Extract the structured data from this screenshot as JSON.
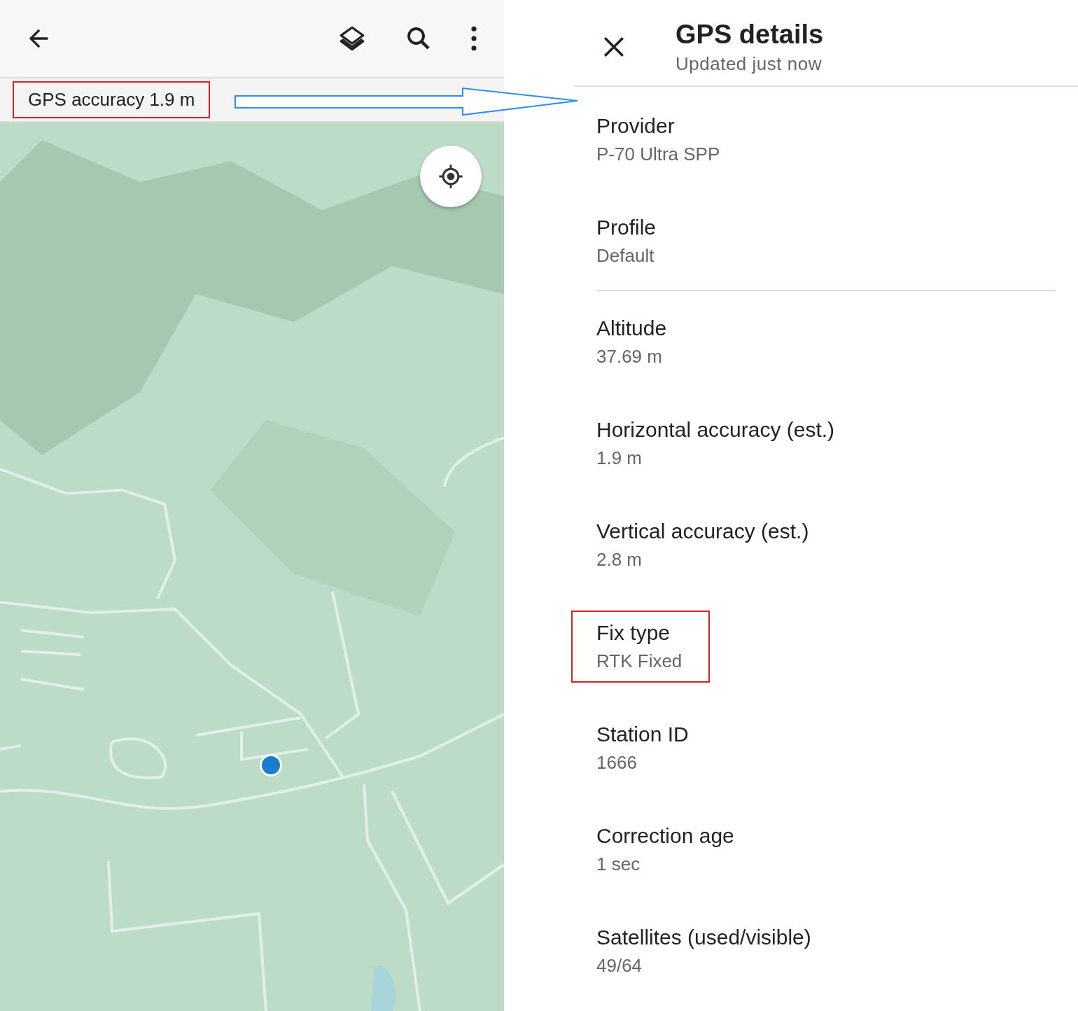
{
  "map_panel": {
    "accuracy_chip": {
      "text": "GPS accuracy 1.9 m",
      "highlighted": true
    }
  },
  "details_panel": {
    "title": "GPS details",
    "subtitle": "Updated just now",
    "items": [
      {
        "label": "Provider",
        "value": "P-70 Ultra SPP",
        "divider_after": false,
        "highlighted": false
      },
      {
        "label": "Profile",
        "value": "Default",
        "divider_after": true,
        "highlighted": false
      },
      {
        "label": "Altitude",
        "value": "37.69 m",
        "divider_after": false,
        "highlighted": false
      },
      {
        "label": "Horizontal accuracy (est.)",
        "value": "1.9 m",
        "divider_after": false,
        "highlighted": false
      },
      {
        "label": "Vertical accuracy (est.)",
        "value": "2.8 m",
        "divider_after": false,
        "highlighted": false
      },
      {
        "label": "Fix type",
        "value": "RTK Fixed",
        "divider_after": false,
        "highlighted": true
      },
      {
        "label": "Station ID",
        "value": "1666",
        "divider_after": false,
        "highlighted": false
      },
      {
        "label": "Correction age",
        "value": "1 sec",
        "divider_after": false,
        "highlighted": false
      },
      {
        "label": "Satellites (used/visible)",
        "value": "49/64",
        "divider_after": false,
        "highlighted": false
      }
    ]
  }
}
